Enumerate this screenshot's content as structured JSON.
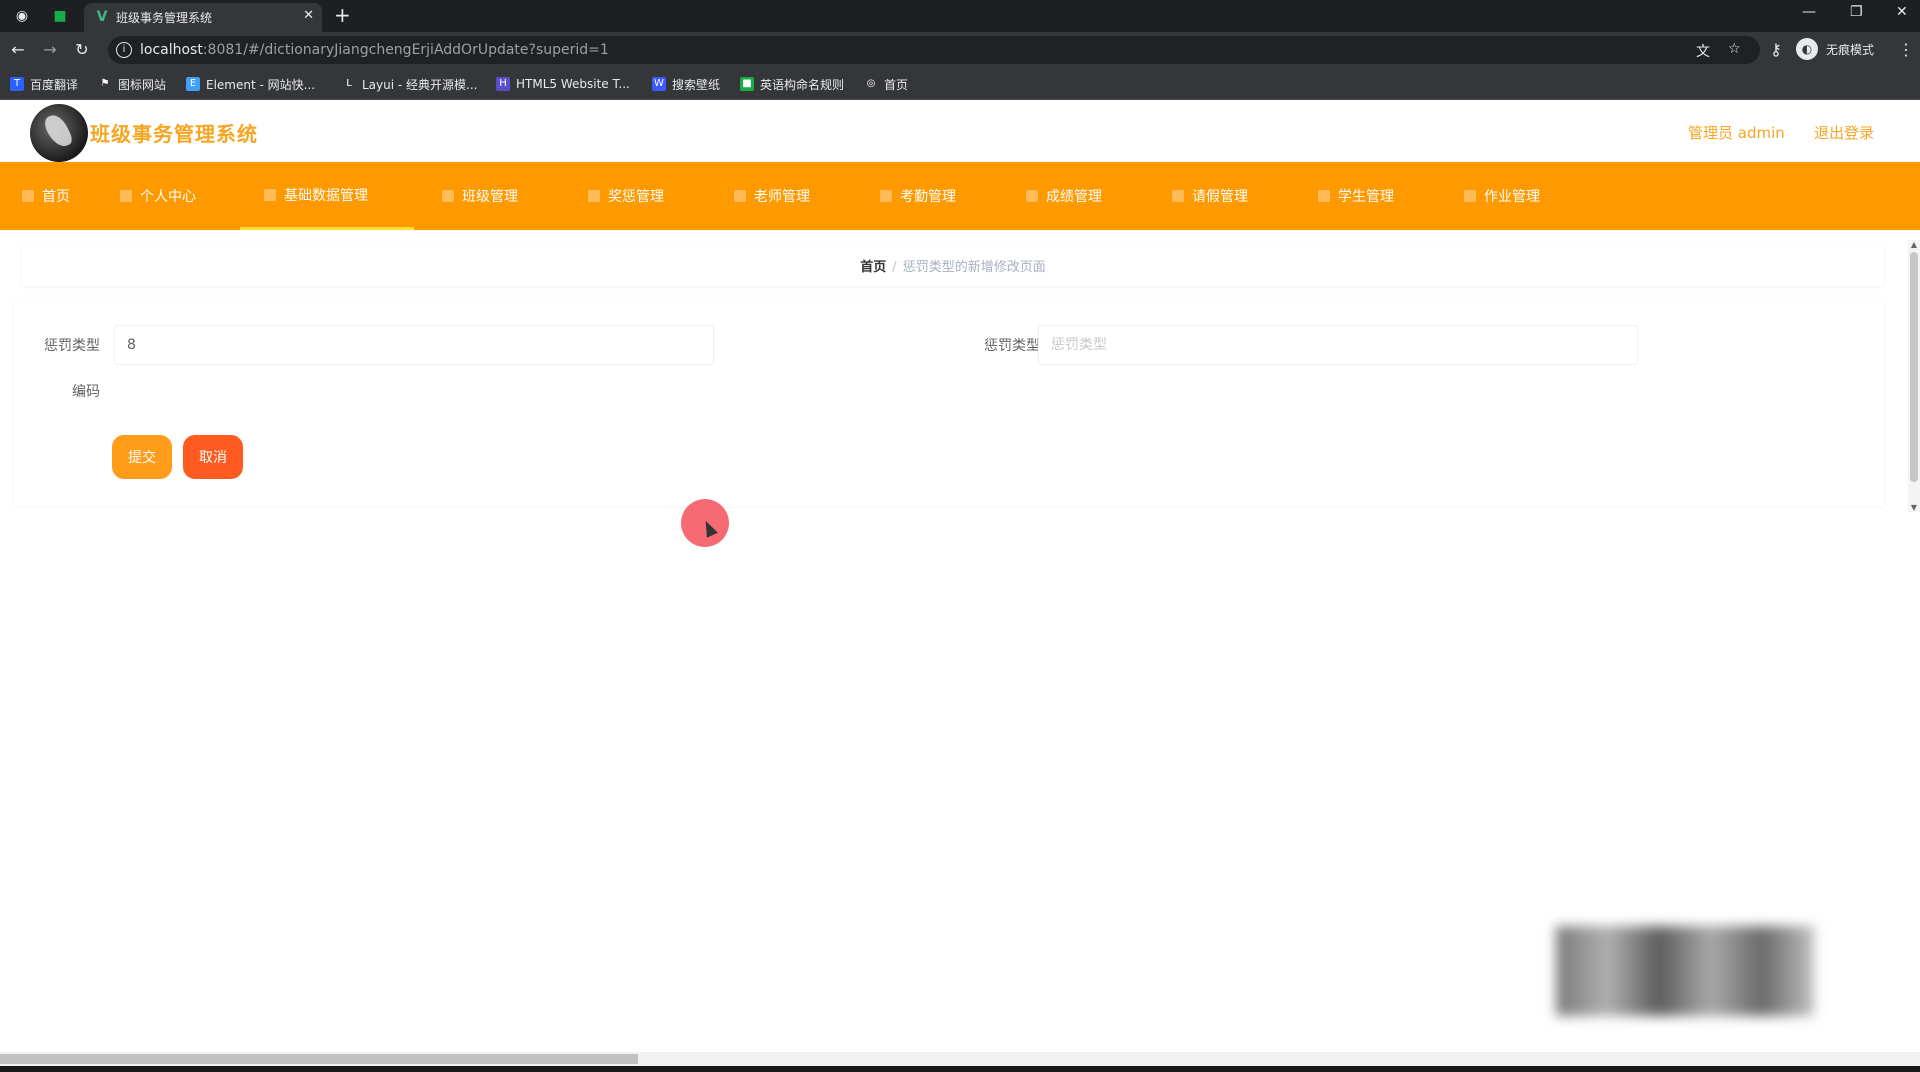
{
  "browser": {
    "tab_title": "班级事务管理系统",
    "tab_close": "✕",
    "new_tab": "+",
    "url_host": "localhost",
    "url_rest": ":8081/#/dictionaryJiangchengErjiAddOrUpdate?superid=1",
    "profile_label": "无痕模式",
    "icons": {
      "back": "arrow-left-icon",
      "forward": "arrow-right-icon",
      "reload": "reload-icon",
      "info": "info-icon",
      "translate": "translate-icon",
      "star": "star-icon",
      "key": "key-icon",
      "menu": "kebab-icon"
    },
    "bookmarks": [
      {
        "label": "百度翻译",
        "color": "#2962ff",
        "glyph": "T"
      },
      {
        "label": "图标网站",
        "color": "#35363a",
        "glyph": "⚑"
      },
      {
        "label": "Element - 网站快...",
        "color": "#409eff",
        "glyph": "E"
      },
      {
        "label": "Layui - 经典开源模...",
        "color": "#35363a",
        "glyph": "L"
      },
      {
        "label": "HTML5 Website T...",
        "color": "#5b4ec9",
        "glyph": "H"
      },
      {
        "label": "搜索壁纸",
        "color": "#3d5afe",
        "glyph": "W"
      },
      {
        "label": "英语构命名规则",
        "color": "#1aab4b",
        "glyph": "■"
      },
      {
        "label": "首页",
        "color": "#35363a",
        "glyph": "◎"
      }
    ]
  },
  "app": {
    "title": "班级事务管理系统",
    "admin_label": "管理员 admin",
    "logout_label": "退出登录"
  },
  "menu": [
    {
      "label": "首页",
      "active": false
    },
    {
      "label": "个人中心",
      "active": false
    },
    {
      "label": "基础数据管理",
      "active": true
    },
    {
      "label": "班级管理",
      "active": false
    },
    {
      "label": "奖惩管理",
      "active": false
    },
    {
      "label": "老师管理",
      "active": false
    },
    {
      "label": "考勤管理",
      "active": false
    },
    {
      "label": "成绩管理",
      "active": false
    },
    {
      "label": "请假管理",
      "active": false
    },
    {
      "label": "学生管理",
      "active": false
    },
    {
      "label": "作业管理",
      "active": false
    }
  ],
  "breadcrumb": {
    "home": "首页",
    "separator": "/",
    "current": "惩罚类型的新增修改页面"
  },
  "form": {
    "field1_label": "惩罚类型",
    "field1_value": "8",
    "field2_label": "惩罚类型",
    "field2_placeholder": "惩罚类型",
    "field3_label": "编码",
    "submit_label": "提交",
    "cancel_label": "取消"
  },
  "colors": {
    "accent": "#ff9900",
    "title": "#f5a623",
    "submit": "#ff9d1a",
    "cancel": "#ff5a1f"
  }
}
